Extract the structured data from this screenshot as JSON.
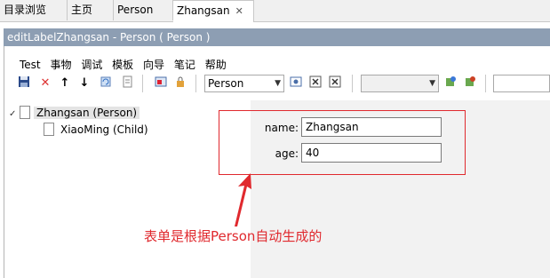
{
  "tabs": [
    {
      "label": "目录浏览"
    },
    {
      "label": "主页"
    },
    {
      "label": "Person"
    },
    {
      "label": "Zhangsan",
      "active": true,
      "close": "✕"
    }
  ],
  "editor": {
    "title": "editLabelZhangsan - Person ( Person )"
  },
  "menu": [
    "Test",
    "事物",
    "调试",
    "模板",
    "向导",
    "笔记",
    "帮助"
  ],
  "toolbar": {
    "combo1_value": "Person",
    "combo2_value": ""
  },
  "tree": {
    "root": {
      "label": "Zhangsan (Person)"
    },
    "child": {
      "label": "XiaoMing (Child)"
    }
  },
  "form": {
    "name_label": "name:",
    "name_value": "Zhangsan",
    "age_label": "age:",
    "age_value": "40"
  },
  "annotation": {
    "text": "表单是根据Person自动生成的",
    "color": "#e0292e"
  }
}
